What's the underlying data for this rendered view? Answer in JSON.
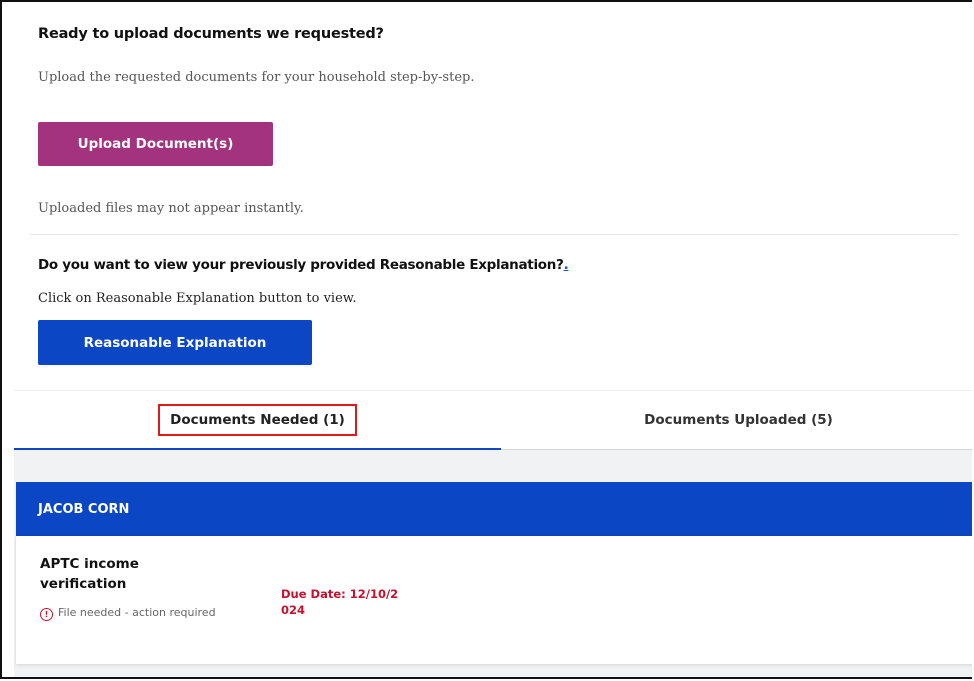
{
  "upload": {
    "heading": "Ready to upload documents we requested?",
    "description": "Upload the requested documents for your household step-by-step.",
    "button_label": "Upload Document(s)",
    "note": "Uploaded files may not appear instantly."
  },
  "reasonable": {
    "heading": "Do you want to view your previously provided Reasonable Explanation?",
    "heading_suffix": ".",
    "description": "Click on Reasonable Explanation button to view.",
    "button_label": "Reasonable Explanation"
  },
  "tabs": [
    {
      "label": "Documents Needed (1)",
      "active": true
    },
    {
      "label": "Documents Uploaded (5)",
      "active": false
    }
  ],
  "person": {
    "name": "JACOB CORN"
  },
  "document": {
    "title": "APTC income verification",
    "status": "File needed - action required",
    "due_label": "Due Date:",
    "due_date": "12/10/2024"
  },
  "colors": {
    "upload_button": "#a3337f",
    "primary_blue": "#0b47c4",
    "due_red": "#c8102e",
    "highlight_box": "#e0191a"
  },
  "icons": {
    "status_icon": "info-circle-icon"
  }
}
